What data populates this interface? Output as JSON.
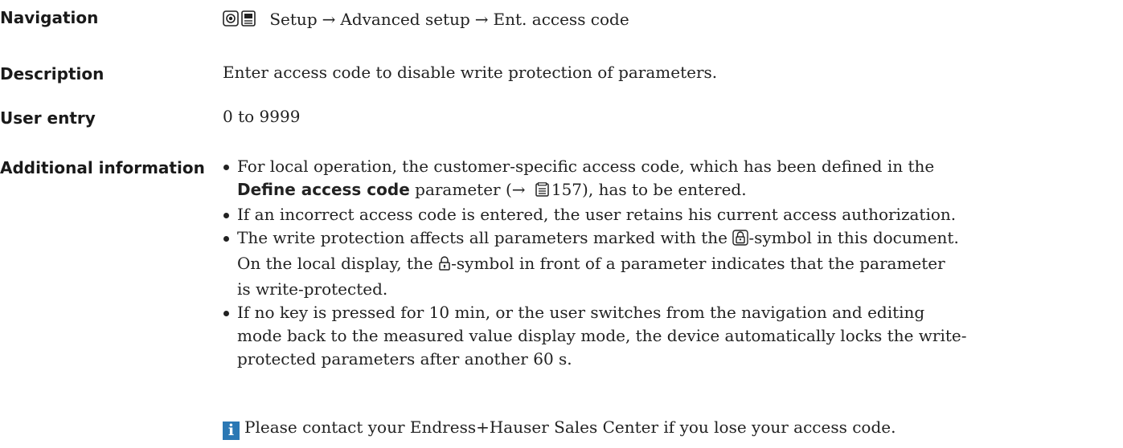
{
  "navigation": {
    "label": "Navigation",
    "path": [
      "Setup",
      "Advanced setup",
      "Ent. access code"
    ],
    "separator": "→",
    "icons": [
      "eye-display-icon",
      "keypad-display-icon"
    ]
  },
  "description": {
    "label": "Description",
    "text": "Enter access code to disable write protection of parameters."
  },
  "user_entry": {
    "label": "User entry",
    "text": "0 to 9999"
  },
  "additional_information": {
    "label": "Additional information",
    "bullet1": {
      "line1": "For local operation, the customer-specific access code, which has been defined in the",
      "param_name": "Define access code",
      "after_param": " parameter (→ ",
      "page_ref": "157",
      "end": "), has to be entered."
    },
    "bullet2": "If an incorrect access code is entered, the user retains his current access authorization.",
    "bullet3": {
      "line1_a": "The write protection affects all parameters marked with the ",
      "line1_b": "-symbol in this document.",
      "line2_a": "On the local display, the ",
      "line2_b": "-symbol in front of a parameter indicates that the parameter",
      "line3": "is write-protected."
    },
    "bullet4": {
      "line1": "If no key is pressed for 10 min, or the user switches from the navigation and editing",
      "line2": "mode back to the measured value display mode, the device automatically locks the write-",
      "line3": "protected parameters after another 60 s."
    }
  },
  "note": {
    "icon": "info-icon",
    "icon_glyph": "i",
    "text": "Please contact your Endress+Hauser Sales Center if you lose your access code."
  }
}
